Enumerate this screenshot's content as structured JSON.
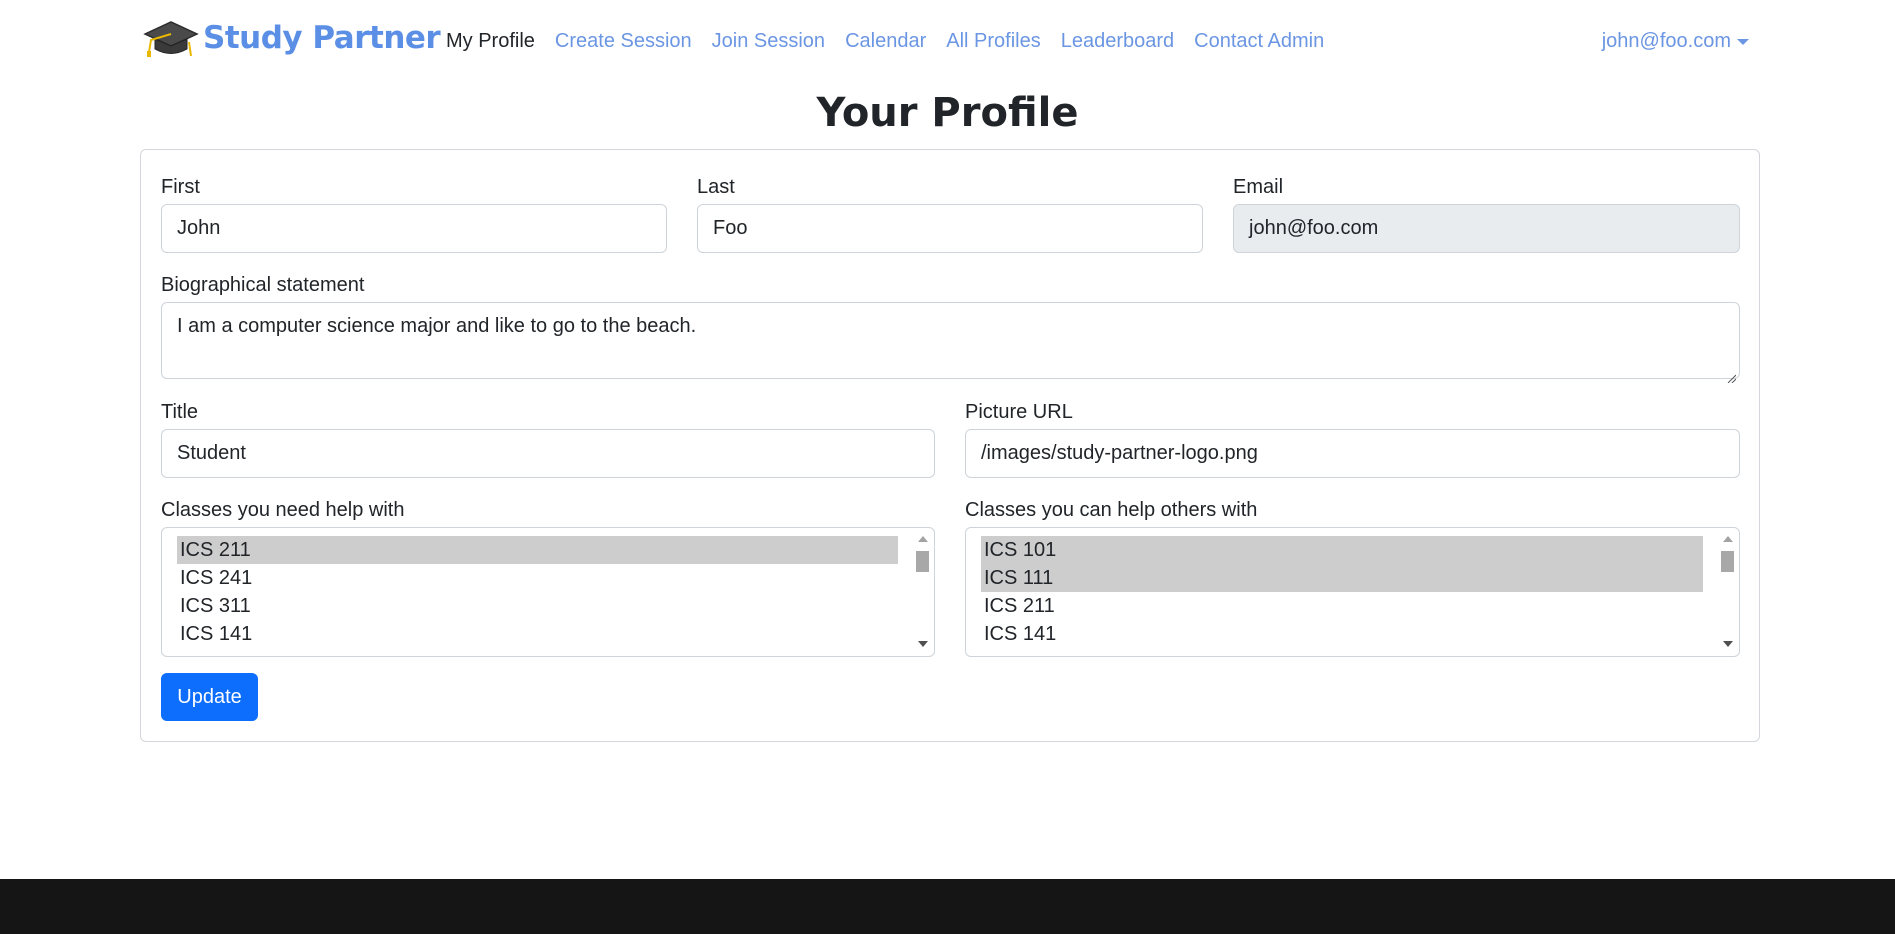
{
  "navbar": {
    "brand": "Study Partner",
    "links": [
      {
        "label": "My Profile",
        "active": true
      },
      {
        "label": "Create Session",
        "active": false
      },
      {
        "label": "Join Session",
        "active": false
      },
      {
        "label": "Calendar",
        "active": false
      },
      {
        "label": "All Profiles",
        "active": false
      },
      {
        "label": "Leaderboard",
        "active": false
      },
      {
        "label": "Contact Admin",
        "active": false
      }
    ],
    "user": "john@foo.com",
    "link_color": "#6b96e3",
    "brand_color": "#5b8fe6"
  },
  "page": {
    "title": "Your Profile"
  },
  "form": {
    "first": {
      "label": "First",
      "value": "John"
    },
    "last": {
      "label": "Last",
      "value": "Foo"
    },
    "email": {
      "label": "Email",
      "value": "john@foo.com",
      "disabled": true
    },
    "bio": {
      "label": "Biographical statement",
      "value": "I am a computer science major and like to go to the beach."
    },
    "title": {
      "label": "Title",
      "value": "Student"
    },
    "picture": {
      "label": "Picture URL",
      "value": "/images/study-partner-logo.png"
    },
    "need_help": {
      "label": "Classes you need help with",
      "options": [
        {
          "label": "ICS 211",
          "selected": true
        },
        {
          "label": "ICS 241",
          "selected": false
        },
        {
          "label": "ICS 311",
          "selected": false
        },
        {
          "label": "ICS 141",
          "selected": false
        }
      ]
    },
    "can_help": {
      "label": "Classes you can help others with",
      "options": [
        {
          "label": "ICS 101",
          "selected": true
        },
        {
          "label": "ICS 111",
          "selected": true
        },
        {
          "label": "ICS 211",
          "selected": false
        },
        {
          "label": "ICS 141",
          "selected": false
        }
      ]
    },
    "submit_label": "Update",
    "button_color": "#0d6efd"
  },
  "icons": {
    "brand_logo": "graduation-cap-icon",
    "user_caret": "caret-down-icon"
  }
}
